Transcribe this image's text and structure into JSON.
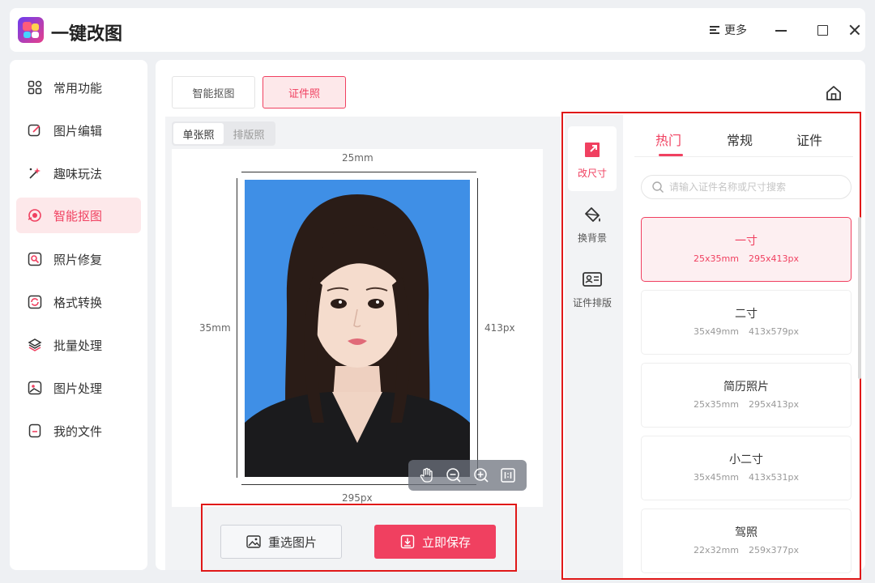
{
  "app": {
    "title": "一键改图"
  },
  "titlebar": {
    "more_label": "更多"
  },
  "sidebar": {
    "items": [
      {
        "label": "常用功能",
        "icon": "grid-icon"
      },
      {
        "label": "图片编辑",
        "icon": "edit-icon"
      },
      {
        "label": "趣味玩法",
        "icon": "magic-icon"
      },
      {
        "label": "智能抠图",
        "icon": "cutout-icon",
        "active": true
      },
      {
        "label": "照片修复",
        "icon": "repair-icon"
      },
      {
        "label": "格式转换",
        "icon": "convert-icon"
      },
      {
        "label": "批量处理",
        "icon": "layers-icon"
      },
      {
        "label": "图片处理",
        "icon": "image-icon"
      },
      {
        "label": "我的文件",
        "icon": "file-icon"
      }
    ]
  },
  "main": {
    "mode_tabs": [
      "智能抠图",
      "证件照"
    ],
    "active_mode": "证件照",
    "sub_tabs": [
      "单张照",
      "排版照"
    ],
    "active_sub_tab": "单张照",
    "dimensions": {
      "width_mm": "25mm",
      "height_mm": "35mm",
      "height_px": "413px",
      "width_px": "295px"
    },
    "reselect_label": "重选图片",
    "save_label": "立即保存"
  },
  "tools": {
    "items": [
      {
        "label": "改尺寸",
        "icon": "resize-icon",
        "active": true
      },
      {
        "label": "换背景",
        "icon": "paint-bucket-icon"
      },
      {
        "label": "证件排版",
        "icon": "id-card-icon"
      }
    ]
  },
  "categories": {
    "tabs": [
      "热门",
      "常规",
      "证件"
    ],
    "active": "热门"
  },
  "search": {
    "placeholder": "请输入证件名称或尺寸搜索"
  },
  "sizes": [
    {
      "name": "一寸",
      "mm": "25x35mm",
      "px": "295x413px",
      "selected": true
    },
    {
      "name": "二寸",
      "mm": "35x49mm",
      "px": "413x579px"
    },
    {
      "name": "简历照片",
      "mm": "25x35mm",
      "px": "295x413px"
    },
    {
      "name": "小二寸",
      "mm": "35x45mm",
      "px": "413x531px"
    },
    {
      "name": "驾照",
      "mm": "22x32mm",
      "px": "259x377px"
    }
  ],
  "colors": {
    "accent": "#f04060",
    "photo_background": "#3f8fe6",
    "highlight_outline": "#e01818"
  }
}
